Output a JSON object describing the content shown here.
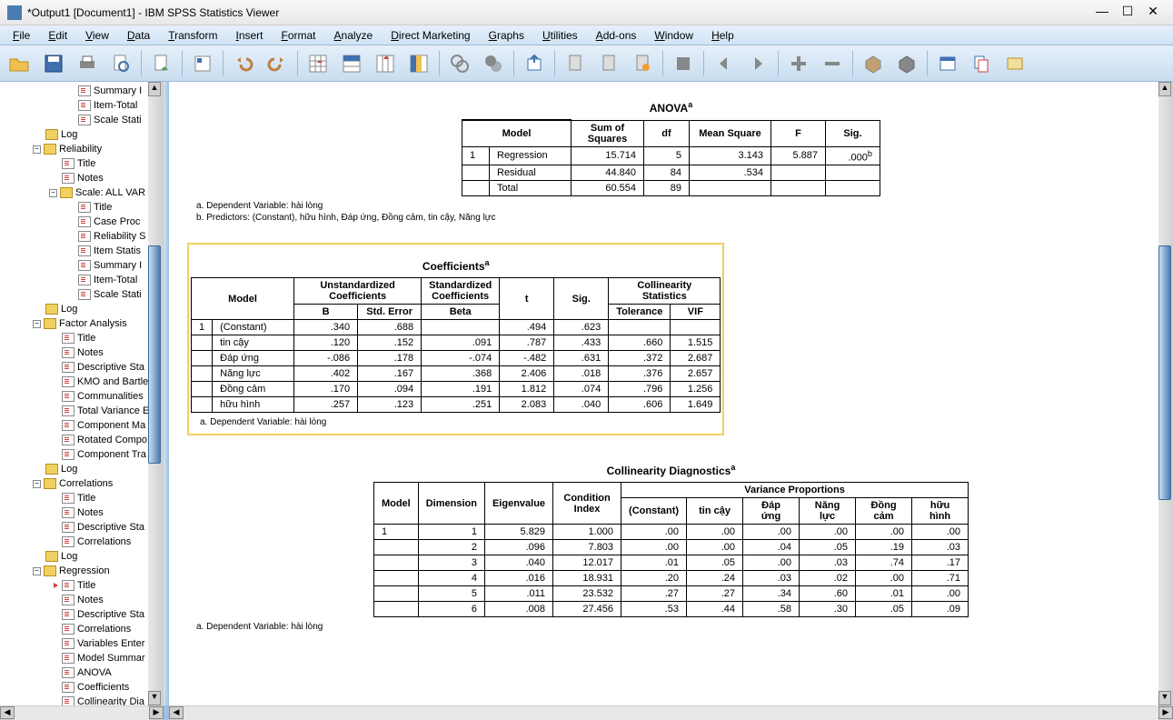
{
  "window": {
    "title": "*Output1 [Document1] - IBM SPSS Statistics Viewer"
  },
  "menu": [
    "File",
    "Edit",
    "View",
    "Data",
    "Transform",
    "Insert",
    "Format",
    "Analyze",
    "Direct Marketing",
    "Graphs",
    "Utilities",
    "Add-ons",
    "Window",
    "Help"
  ],
  "nav": [
    {
      "l": 3,
      "t": "page",
      "lbl": "Summary I"
    },
    {
      "l": 3,
      "t": "page",
      "lbl": "Item-Total"
    },
    {
      "l": 3,
      "t": "page",
      "lbl": "Scale Stati"
    },
    {
      "l": 1,
      "t": "book",
      "lbl": "Log"
    },
    {
      "l": 1,
      "t": "book",
      "lbl": "Reliability",
      "exp": "-"
    },
    {
      "l": 2,
      "t": "page",
      "lbl": "Title"
    },
    {
      "l": 2,
      "t": "page",
      "lbl": "Notes"
    },
    {
      "l": 2,
      "t": "book",
      "lbl": "Scale: ALL VAR",
      "exp": "-"
    },
    {
      "l": 3,
      "t": "page",
      "lbl": "Title"
    },
    {
      "l": 3,
      "t": "page",
      "lbl": "Case Proc"
    },
    {
      "l": 3,
      "t": "page",
      "lbl": "Reliability S"
    },
    {
      "l": 3,
      "t": "page",
      "lbl": "Item Statis"
    },
    {
      "l": 3,
      "t": "page",
      "lbl": "Summary I"
    },
    {
      "l": 3,
      "t": "page",
      "lbl": "Item-Total"
    },
    {
      "l": 3,
      "t": "page",
      "lbl": "Scale Stati"
    },
    {
      "l": 1,
      "t": "book",
      "lbl": "Log"
    },
    {
      "l": 1,
      "t": "book",
      "lbl": "Factor Analysis",
      "exp": "-"
    },
    {
      "l": 2,
      "t": "page",
      "lbl": "Title"
    },
    {
      "l": 2,
      "t": "page",
      "lbl": "Notes"
    },
    {
      "l": 2,
      "t": "page",
      "lbl": "Descriptive Sta"
    },
    {
      "l": 2,
      "t": "page",
      "lbl": "KMO and Bartle"
    },
    {
      "l": 2,
      "t": "page",
      "lbl": "Communalities"
    },
    {
      "l": 2,
      "t": "page",
      "lbl": "Total Variance E"
    },
    {
      "l": 2,
      "t": "page",
      "lbl": "Component Ma"
    },
    {
      "l": 2,
      "t": "page",
      "lbl": "Rotated Compo"
    },
    {
      "l": 2,
      "t": "page",
      "lbl": "Component Tra"
    },
    {
      "l": 1,
      "t": "book",
      "lbl": "Log"
    },
    {
      "l": 1,
      "t": "book",
      "lbl": "Correlations",
      "exp": "-"
    },
    {
      "l": 2,
      "t": "page",
      "lbl": "Title"
    },
    {
      "l": 2,
      "t": "page",
      "lbl": "Notes"
    },
    {
      "l": 2,
      "t": "page",
      "lbl": "Descriptive Sta"
    },
    {
      "l": 2,
      "t": "page",
      "lbl": "Correlations"
    },
    {
      "l": 1,
      "t": "book",
      "lbl": "Log"
    },
    {
      "l": 1,
      "t": "book",
      "lbl": "Regression",
      "exp": "-"
    },
    {
      "l": 2,
      "t": "page",
      "lbl": "Title",
      "active": true
    },
    {
      "l": 2,
      "t": "page",
      "lbl": "Notes"
    },
    {
      "l": 2,
      "t": "page",
      "lbl": "Descriptive Sta"
    },
    {
      "l": 2,
      "t": "page",
      "lbl": "Correlations"
    },
    {
      "l": 2,
      "t": "page",
      "lbl": "Variables Enter"
    },
    {
      "l": 2,
      "t": "page",
      "lbl": "Model Summar"
    },
    {
      "l": 2,
      "t": "page",
      "lbl": "ANOVA"
    },
    {
      "l": 2,
      "t": "page",
      "lbl": "Coefficients"
    },
    {
      "l": 2,
      "t": "page",
      "lbl": "Collinearity Dia"
    }
  ],
  "anova": {
    "title": "ANOVA",
    "headers": [
      "Model",
      "",
      "Sum of Squares",
      "df",
      "Mean Square",
      "F",
      "Sig."
    ],
    "rows": [
      [
        "1",
        "Regression",
        "15.714",
        "5",
        "3.143",
        "5.887",
        ".000"
      ],
      [
        "",
        "Residual",
        "44.840",
        "84",
        ".534",
        "",
        ""
      ],
      [
        "",
        "Total",
        "60.554",
        "89",
        "",
        "",
        ""
      ]
    ],
    "foot": [
      "a. Dependent Variable: hài lòng",
      "b. Predictors: (Constant), hữu hình, Đáp ứng, Đồng cảm, tin cậy, Năng lực"
    ]
  },
  "coef": {
    "title": "Coefficients",
    "h1": [
      "Model",
      "Unstandardized Coefficients",
      "Standardized Coefficients",
      "t",
      "Sig.",
      "Collinearity Statistics"
    ],
    "h2": [
      "B",
      "Std. Error",
      "Beta",
      "Tolerance",
      "VIF"
    ],
    "rows": [
      [
        "1",
        "(Constant)",
        ".340",
        ".688",
        "",
        ".494",
        ".623",
        "",
        ""
      ],
      [
        "",
        "tin cậy",
        ".120",
        ".152",
        ".091",
        ".787",
        ".433",
        ".660",
        "1.515"
      ],
      [
        "",
        "Đáp ứng",
        "-.086",
        ".178",
        "-.074",
        "-.482",
        ".631",
        ".372",
        "2.687"
      ],
      [
        "",
        "Năng lực",
        ".402",
        ".167",
        ".368",
        "2.406",
        ".018",
        ".376",
        "2.657"
      ],
      [
        "",
        "Đồng cảm",
        ".170",
        ".094",
        ".191",
        "1.812",
        ".074",
        ".796",
        "1.256"
      ],
      [
        "",
        "hữu hình",
        ".257",
        ".123",
        ".251",
        "2.083",
        ".040",
        ".606",
        "1.649"
      ]
    ],
    "foot": [
      "a. Dependent Variable: hài lòng"
    ]
  },
  "collin": {
    "title": "Collinearity Diagnostics",
    "h1": [
      "Model",
      "Dimension",
      "Eigenvalue",
      "Condition Index",
      "Variance Proportions"
    ],
    "h2": [
      "(Constant)",
      "tin cậy",
      "Đáp ứng",
      "Năng lực",
      "Đồng cảm",
      "hữu hình"
    ],
    "rows": [
      [
        "1",
        "1",
        "5.829",
        "1.000",
        ".00",
        ".00",
        ".00",
        ".00",
        ".00",
        ".00"
      ],
      [
        "",
        "2",
        ".096",
        "7.803",
        ".00",
        ".00",
        ".04",
        ".05",
        ".19",
        ".03"
      ],
      [
        "",
        "3",
        ".040",
        "12.017",
        ".01",
        ".05",
        ".00",
        ".03",
        ".74",
        ".17"
      ],
      [
        "",
        "4",
        ".016",
        "18.931",
        ".20",
        ".24",
        ".03",
        ".02",
        ".00",
        ".71"
      ],
      [
        "",
        "5",
        ".011",
        "23.532",
        ".27",
        ".27",
        ".34",
        ".60",
        ".01",
        ".00"
      ],
      [
        "",
        "6",
        ".008",
        "27.456",
        ".53",
        ".44",
        ".58",
        ".30",
        ".05",
        ".09"
      ]
    ],
    "foot": [
      "a. Dependent Variable: hài lòng"
    ]
  }
}
